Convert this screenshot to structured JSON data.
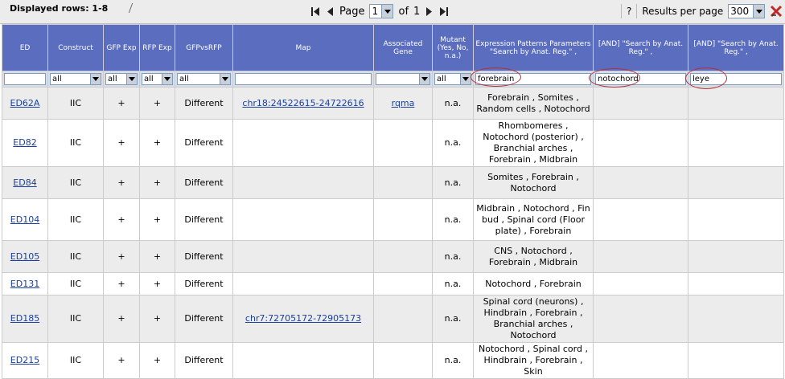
{
  "toolbar": {
    "displayed_rows": "Displayed rows: 1-8",
    "page_label": "Page",
    "page_value": "1",
    "of_label": "of",
    "page_total": "1",
    "help": "?",
    "results_label": "Results per page",
    "results_value": "300"
  },
  "headers": [
    "ED",
    "Construct",
    "GFP Exp",
    "RFP Exp",
    "GFPvsRFP",
    "Map",
    "Associated Gene",
    "Mutant (Yes, No, n.a.)",
    "Expression Patterns Parameters \"Search by Anat. Reg.\"   ,",
    "[AND] \"Search by Anat. Reg.\" ,",
    "[AND] \"Search by Anat. Reg.\" ,"
  ],
  "filters": {
    "ed": "",
    "construct": "all",
    "gfp": "all",
    "rfp": "all",
    "gfpvsrfp": "all",
    "map": "",
    "gene": "",
    "mutant": "all",
    "expr1": "forebrain",
    "expr2": "notochord",
    "expr3": "leye"
  },
  "rows": [
    {
      "ed": "ED62A",
      "construct": "IIC",
      "gfp": "+",
      "rfp": "+",
      "gfpvsrfp": "Different",
      "map": "chr18:24522615-24722616",
      "gene": "rqma",
      "mutant": "n.a.",
      "expr": "Forebrain , Somites , Random cells , Notochord"
    },
    {
      "ed": "ED82",
      "construct": "IIC",
      "gfp": "+",
      "rfp": "+",
      "gfpvsrfp": "Different",
      "map": "",
      "gene": "",
      "mutant": "n.a.",
      "expr": "Rhombomeres , Notochord (posterior) , Branchial arches , Forebrain , Midbrain"
    },
    {
      "ed": "ED84",
      "construct": "IIC",
      "gfp": "+",
      "rfp": "+",
      "gfpvsrfp": "Different",
      "map": "",
      "gene": "",
      "mutant": "n.a.",
      "expr": "Somites , Forebrain , Notochord"
    },
    {
      "ed": "ED104",
      "construct": "IIC",
      "gfp": "+",
      "rfp": "+",
      "gfpvsrfp": "Different",
      "map": "",
      "gene": "",
      "mutant": "n.a.",
      "expr": "Midbrain , Notochord , Fin bud , Spinal cord (Floor plate) , Forebrain"
    },
    {
      "ed": "ED105",
      "construct": "IIC",
      "gfp": "+",
      "rfp": "+",
      "gfpvsrfp": "Different",
      "map": "",
      "gene": "",
      "mutant": "n.a.",
      "expr": "CNS , Notochord , Forebrain , Midbrain"
    },
    {
      "ed": "ED131",
      "construct": "IIC",
      "gfp": "+",
      "rfp": "+",
      "gfpvsrfp": "Different",
      "map": "",
      "gene": "",
      "mutant": "n.a.",
      "expr": "Notochord , Forebrain"
    },
    {
      "ed": "ED185",
      "construct": "IIC",
      "gfp": "+",
      "rfp": "+",
      "gfpvsrfp": "Different",
      "map": "chr7:72705172-72905173",
      "gene": "",
      "mutant": "n.a.",
      "expr": "Spinal cord (neurons) , Hindbrain , Forebrain , Branchial arches , Notochord"
    },
    {
      "ed": "ED215",
      "construct": "IIC",
      "gfp": "+",
      "rfp": "+",
      "gfpvsrfp": "Different",
      "map": "",
      "gene": "",
      "mutant": "n.a.",
      "expr": "Notochord , Spinal cord , Hindbrain , Forebrain , Skin"
    }
  ],
  "colors": {
    "header_bg": "#5a6dbe",
    "link": "#1a3f9e",
    "highlight": "#b4323a"
  }
}
